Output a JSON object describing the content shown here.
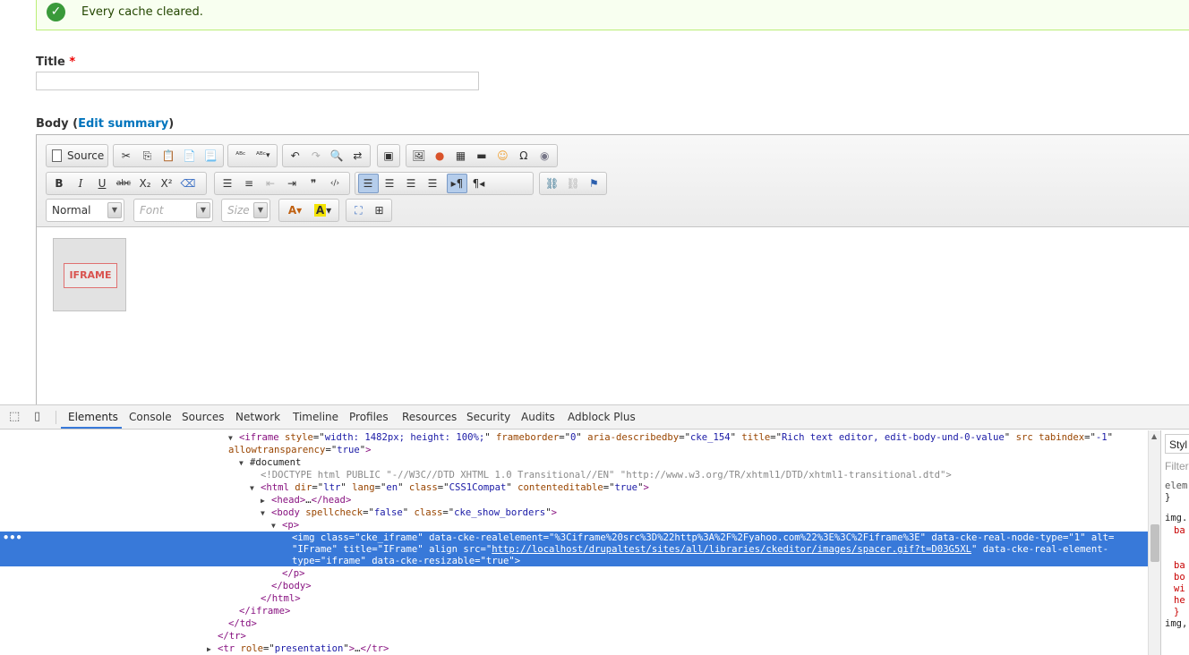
{
  "status": {
    "message": "Every cache cleared."
  },
  "form": {
    "title_label": "Title",
    "required_mark": "*",
    "body_label": "Body (",
    "edit_summary": "Edit summary",
    "body_label_close": ")"
  },
  "editor": {
    "source_label": "Source",
    "format_value": "Normal",
    "font_placeholder": "Font",
    "size_placeholder": "Size",
    "iframe_placeholder": "IFRAME"
  },
  "devtools": {
    "tabs": [
      "Elements",
      "Console",
      "Sources",
      "Network",
      "Timeline",
      "Profiles",
      "Resources",
      "Security",
      "Audits",
      "Adblock Plus"
    ],
    "styles_tab": "Styl",
    "filter_placeholder": "Filter",
    "styles_lines": [
      "elem",
      "}",
      "img.",
      "ba",
      "ba",
      "bo",
      "wi",
      "he",
      "}",
      "img,"
    ]
  }
}
